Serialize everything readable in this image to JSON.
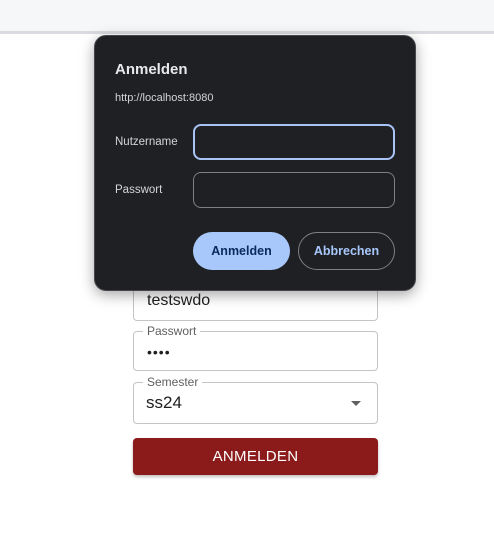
{
  "login_form": {
    "username_value": "testswdo",
    "password_label": "Passwort",
    "password_value": "••••",
    "semester_label": "Semester",
    "semester_value": "ss24",
    "submit_label": "ANMELDEN"
  },
  "auth_dialog": {
    "title": "Anmelden",
    "origin": "http://localhost:8080",
    "username_label": "Nutzername",
    "username_value": "",
    "password_label": "Passwort",
    "password_value": "",
    "confirm_label": "Anmelden",
    "cancel_label": "Abbrechen"
  },
  "colors": {
    "submit_button": "#8b1a1a",
    "dialog_background": "#1f2023",
    "dialog_accent": "#a8c7fa"
  }
}
